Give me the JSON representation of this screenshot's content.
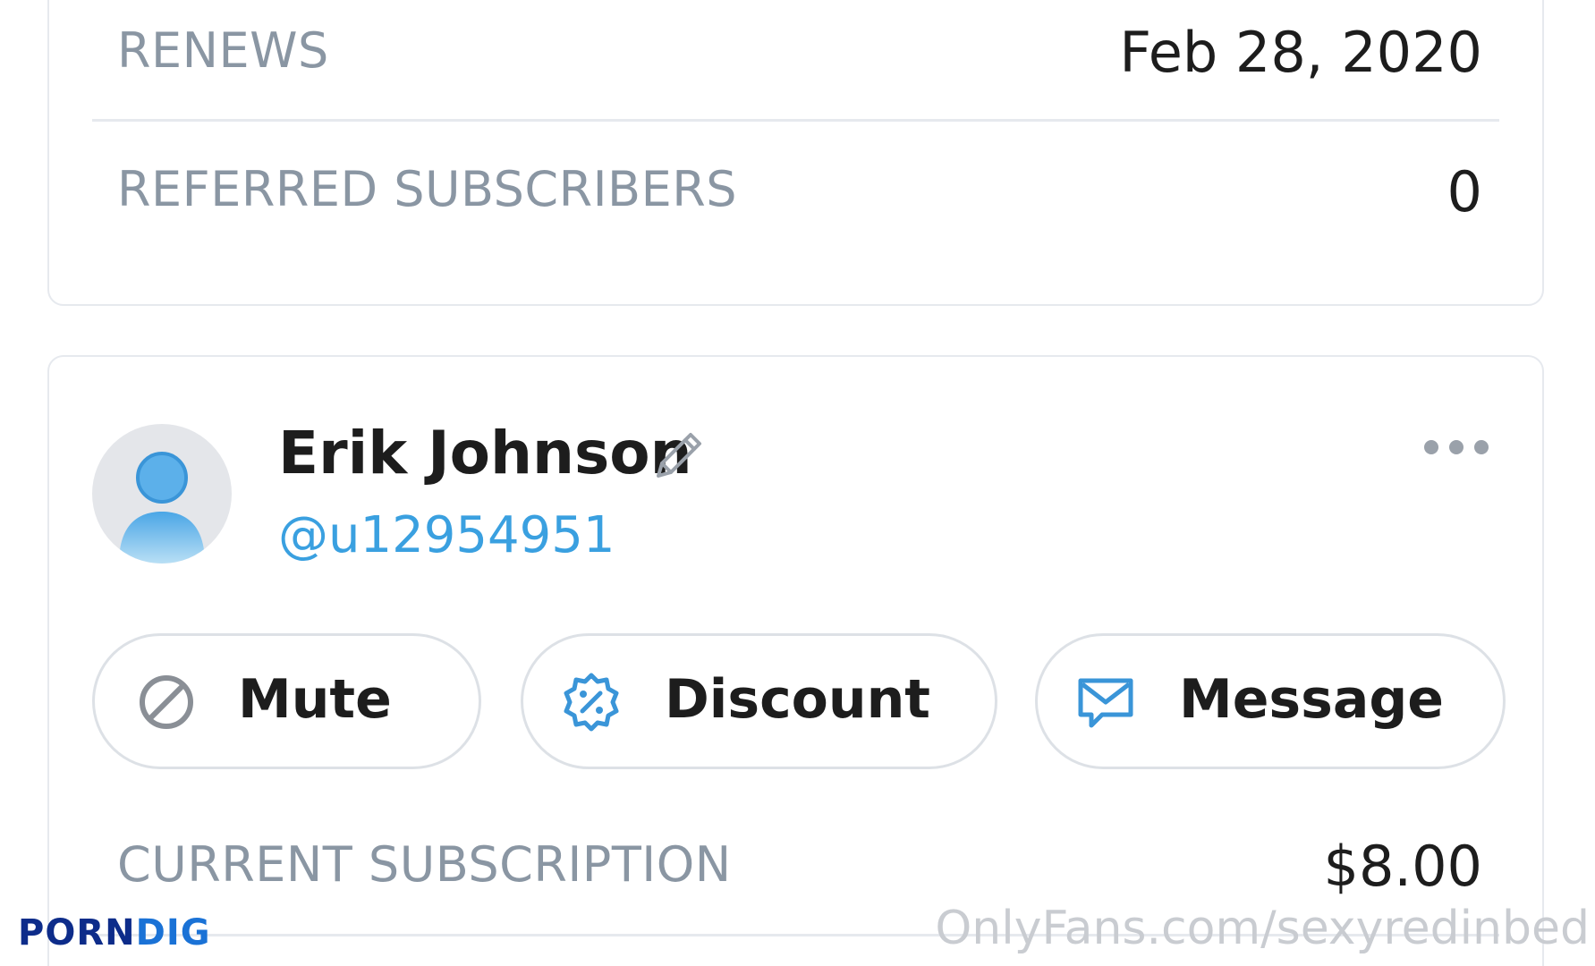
{
  "top_card": {
    "renews_label": "RENEWS",
    "renews_value": "Feb 28, 2020",
    "referred_label": "REFERRED SUBSCRIBERS",
    "referred_value": "0"
  },
  "subscriber": {
    "name": "Erik Johnson",
    "handle": "@u12954951",
    "icons": {
      "avatar": "default-user-avatar",
      "edit": "pencil-icon",
      "more": "more-dots-icon"
    }
  },
  "actions": [
    {
      "label": "Mute",
      "icon": "block-icon"
    },
    {
      "label": "Discount",
      "icon": "discount-badge-icon"
    },
    {
      "label": "Message",
      "icon": "envelope-icon"
    }
  ],
  "subscription": {
    "label": "CURRENT SUBSCRIPTION",
    "value": "$8.00"
  },
  "watermarks": {
    "left_part1": "PORN",
    "left_part2": "DIG",
    "right": "OnlyFans.com/sexyredinbed"
  },
  "colors": {
    "accent": "#3aa0e0",
    "label_gray": "#8a96a3",
    "border": "#e6e9ee",
    "text": "#1d1d1d"
  }
}
